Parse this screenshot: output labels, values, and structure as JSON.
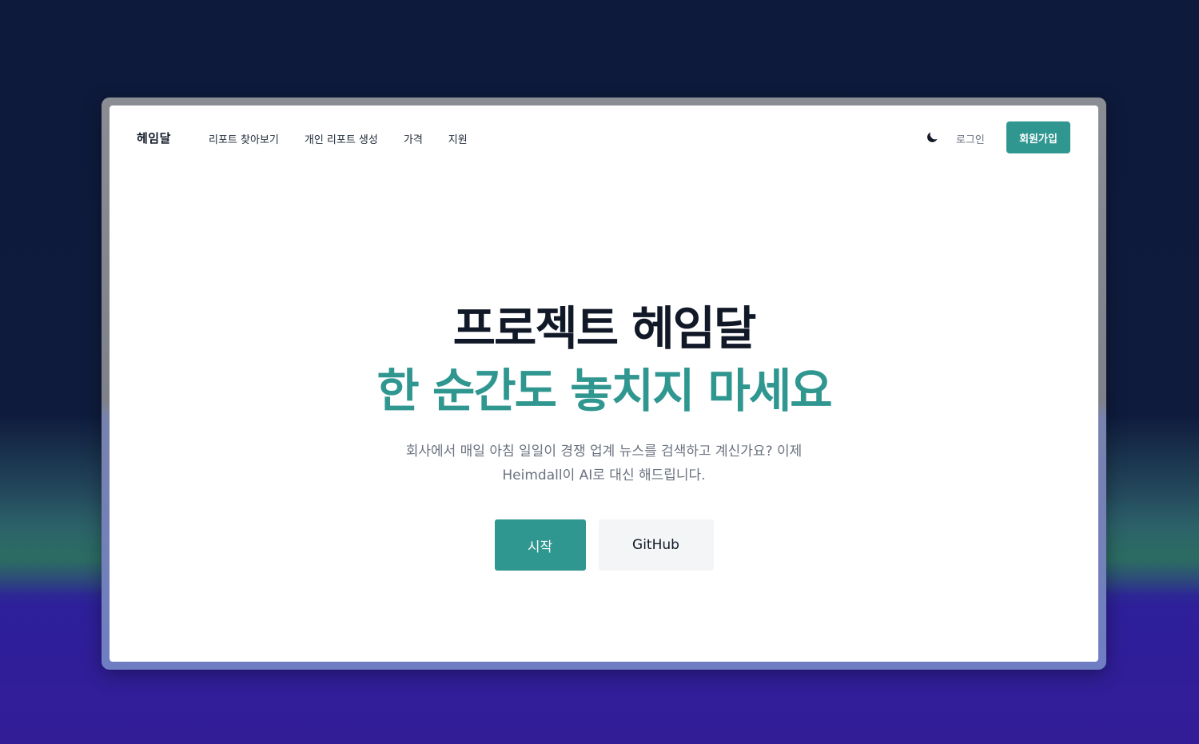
{
  "brand": {
    "logo": "헤임달"
  },
  "nav": {
    "links": [
      "리포트 찾아보기",
      "개인 리포트 생성",
      "가격",
      "지원"
    ],
    "theme_icon": "moon-icon",
    "login_label": "로그인",
    "signup_label": "회원가입"
  },
  "hero": {
    "title": "프로젝트 헤임달",
    "subtitle": "한 순간도 놓치지 마세요",
    "description_line1": "회사에서 매일 아침 일일이 경쟁 업계 뉴스를 검색하고 계신가요? 이제",
    "description_line2": "Heimdall이 AI로 대신 해드립니다.",
    "start_label": "시작",
    "github_label": "GitHub"
  },
  "colors": {
    "accent": "#2f9690",
    "heading": "#111827",
    "muted": "#6b7280",
    "secondary_button_bg": "#f3f5f7"
  }
}
